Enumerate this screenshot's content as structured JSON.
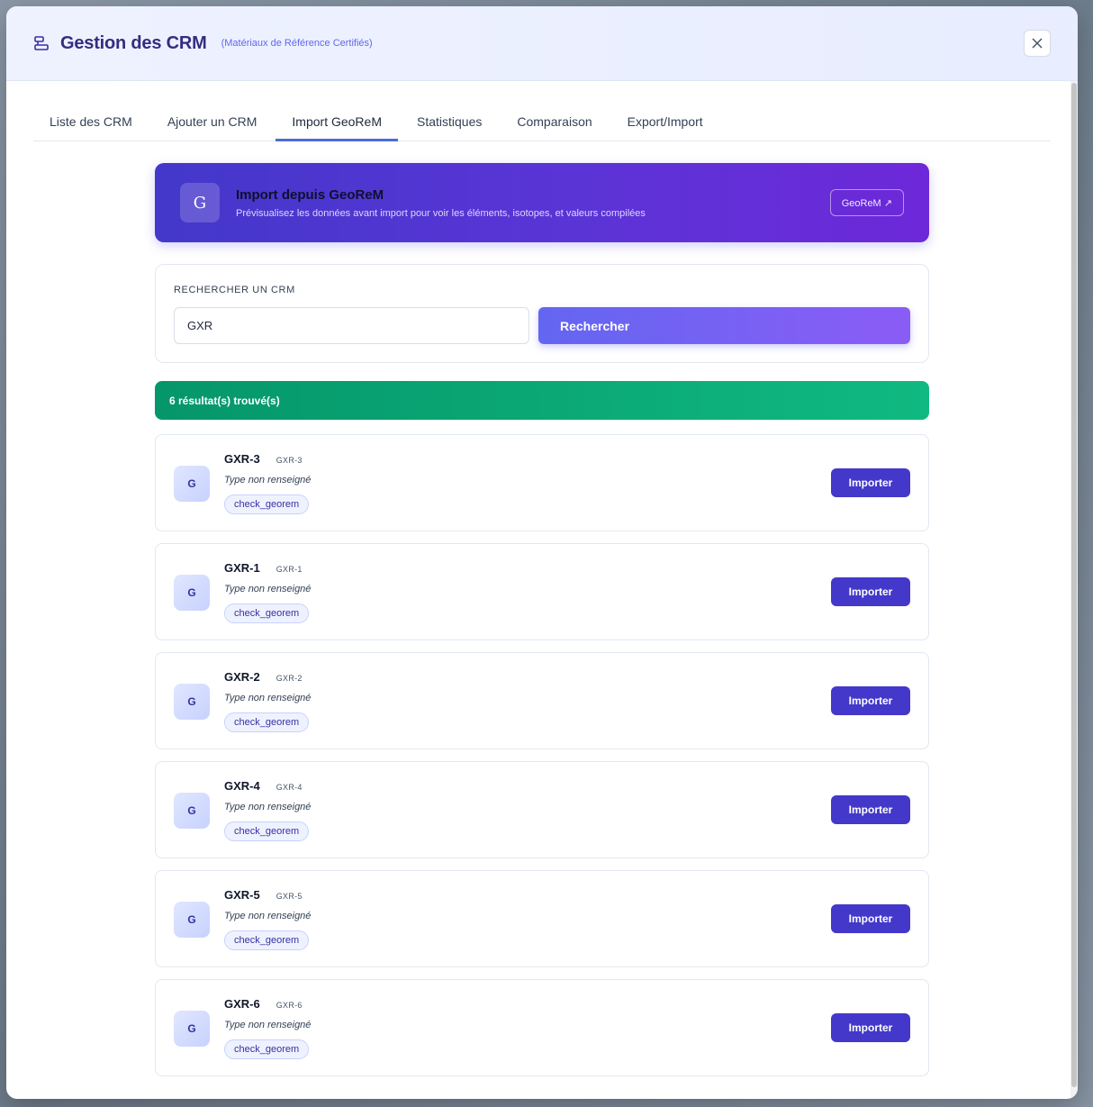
{
  "header": {
    "title": "Gestion des CRM",
    "subtitle": "(Matériaux de Référence Certifiés)"
  },
  "tabs": [
    {
      "label": "Liste des CRM",
      "active": false
    },
    {
      "label": "Ajouter un CRM",
      "active": false
    },
    {
      "label": "Import GeoReM",
      "active": true
    },
    {
      "label": "Statistiques",
      "active": false
    },
    {
      "label": "Comparaison",
      "active": false
    },
    {
      "label": "Export/Import",
      "active": false
    }
  ],
  "banner": {
    "avatar": "G",
    "title": "Import depuis GeoReM",
    "description": "Prévisualisez les données avant import pour voir les éléments, isotopes, et valeurs compilées",
    "link_label": "GeoReM ↗"
  },
  "search": {
    "label": "RECHERCHER UN CRM",
    "value": "GXR",
    "button_label": "Rechercher"
  },
  "results": {
    "summary": "6 résultat(s) trouvé(s)",
    "items": [
      {
        "avatar": "G",
        "name": "GXR-3",
        "code": "GXR-3",
        "type": "Type non renseigné",
        "tag": "check_georem",
        "button": "Importer"
      },
      {
        "avatar": "G",
        "name": "GXR-1",
        "code": "GXR-1",
        "type": "Type non renseigné",
        "tag": "check_georem",
        "button": "Importer"
      },
      {
        "avatar": "G",
        "name": "GXR-2",
        "code": "GXR-2",
        "type": "Type non renseigné",
        "tag": "check_georem",
        "button": "Importer"
      },
      {
        "avatar": "G",
        "name": "GXR-4",
        "code": "GXR-4",
        "type": "Type non renseigné",
        "tag": "check_georem",
        "button": "Importer"
      },
      {
        "avatar": "G",
        "name": "GXR-5",
        "code": "GXR-5",
        "type": "Type non renseigné",
        "tag": "check_georem",
        "button": "Importer"
      },
      {
        "avatar": "G",
        "name": "GXR-6",
        "code": "GXR-6",
        "type": "Type non renseigné",
        "tag": "check_georem",
        "button": "Importer"
      }
    ]
  },
  "icons": {
    "header": "layers-icon",
    "close": "close-icon"
  },
  "colors": {
    "primary": "#4338ca",
    "banner_end": "#6d28d9",
    "success": "#10b981",
    "header_bg": "#eef2ff"
  }
}
